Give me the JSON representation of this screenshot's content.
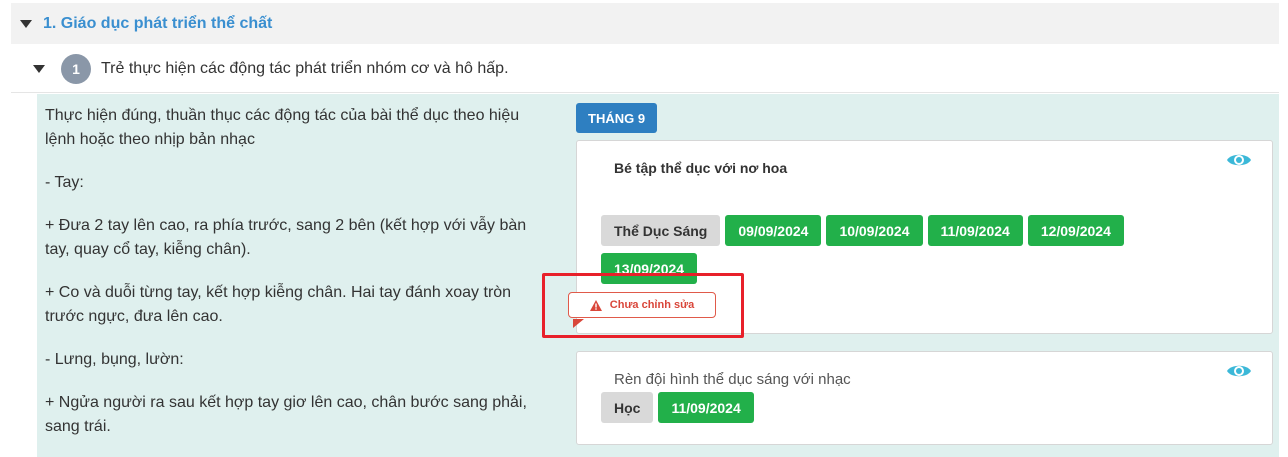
{
  "section": {
    "title": "1. Giáo dục phát triển thể chất"
  },
  "subsection": {
    "number": "1",
    "title": "Trẻ thực hiện các động tác phát triển nhóm cơ và hô hấp."
  },
  "description": [
    "Thực hiện đúng, thuần thục các động tác của bài thể dục theo hiệu lệnh hoặc theo nhịp bản nhạc",
    "- Tay:",
    "+ Đưa 2 tay lên cao, ra phía trước, sang 2 bên (kết hợp với vẫy bàn tay, quay cổ tay, kiễng chân).",
    "+ Co và duỗi từng tay, kết hợp kiễng chân. Hai tay đánh xoay tròn trước ngực, đưa lên cao.",
    "- Lưng, bụng, lườn:",
    "+ Ngửa người ra sau kết hợp tay giơ lên cao, chân bước sang phải, sang trái."
  ],
  "month_badge": "THÁNG 9",
  "activities": [
    {
      "title": "Bé tập thể dục với nơ hoa",
      "type_label": "Thể Dục Sáng",
      "dates": [
        "09/09/2024",
        "10/09/2024",
        "11/09/2024",
        "12/09/2024",
        "13/09/2024"
      ],
      "status": "Chưa chỉnh sửa"
    },
    {
      "title": "Rèn đội hình thể dục sáng với nhạc",
      "type_label": "Học",
      "dates": [
        "11/09/2024"
      ]
    }
  ],
  "colors": {
    "accent": "#3a8fd0",
    "green": "#22b04a",
    "warning": "#d9463a",
    "highlight": "#e8202a",
    "panel": "#dff0ee"
  }
}
